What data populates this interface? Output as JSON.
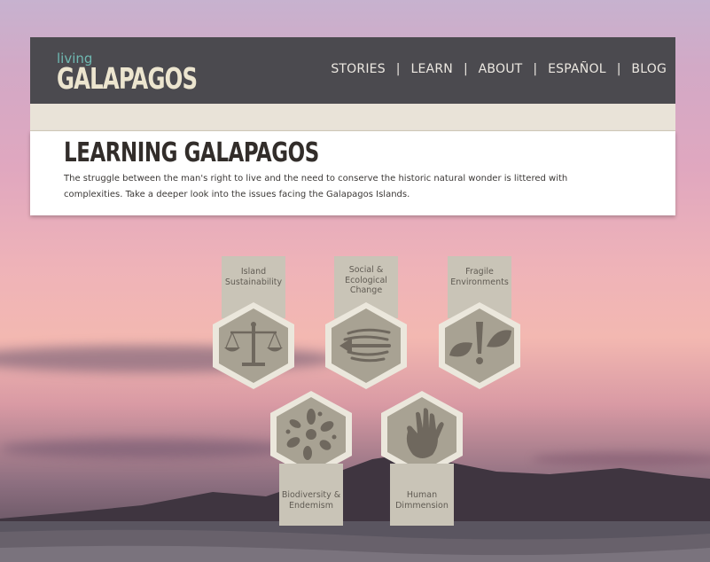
{
  "logo": {
    "small": "living",
    "big": "GALAPAGOS"
  },
  "nav": {
    "items": [
      {
        "label": "STORIES"
      },
      {
        "label": "LEARN"
      },
      {
        "label": "ABOUT"
      },
      {
        "label": "ESPAÑOL"
      },
      {
        "label": "BLOG"
      }
    ],
    "separator": "|"
  },
  "page": {
    "title": "LEARNING GALAPAGOS",
    "description": "The struggle between the man's right to live and the need to conserve the historic natural wonder is littered with complexities. Take a deeper look into the issues facing the Galapagos Islands."
  },
  "topics": [
    {
      "label": "Island Sustainability",
      "icon": "scales-icon"
    },
    {
      "label": "Social & Ecological Change",
      "icon": "arrows-icon"
    },
    {
      "label": "Fragile Environments",
      "icon": "leaves-icon"
    },
    {
      "label": "Biodiversity & Endemism",
      "icon": "splash-icon"
    },
    {
      "label": "Human Dimmension",
      "icon": "hand-icon"
    }
  ],
  "colors": {
    "header_bg": "#4b4a4f",
    "band_bg": "#e9e3d8",
    "logo_accent": "#6fb9b2",
    "logo_text": "#ece5cf",
    "tab_bg": "#c9c4b7",
    "hex_fill": "#a8a293",
    "hex_border": "#ebe7dc",
    "icon_color": "#6f685e"
  }
}
